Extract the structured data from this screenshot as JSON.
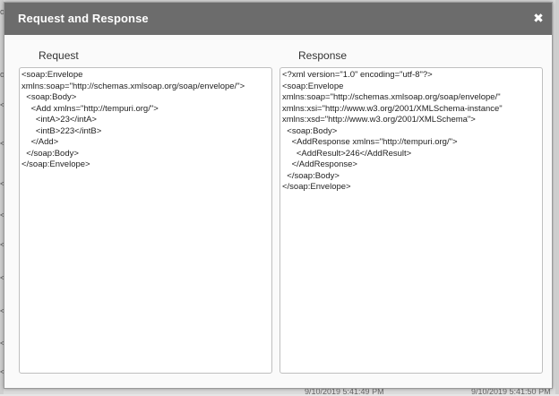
{
  "dialog": {
    "title": "Request and Response",
    "close_glyph": "✖"
  },
  "request": {
    "label": "Request",
    "xml": "<soap:Envelope\nxmlns:soap=\"http://schemas.xmlsoap.org/soap/envelope/\">\n  <soap:Body>\n    <Add xmlns=\"http://tempuri.org/\">\n      <intA>23</intA>\n      <intB>223</intB>\n    </Add>\n  </soap:Body>\n</soap:Envelope>"
  },
  "response": {
    "label": "Response",
    "xml": "<?xml version=\"1.0\" encoding=\"utf-8\"?>\n<soap:Envelope\nxmlns:soap=\"http://schemas.xmlsoap.org/soap/envelope/\"\nxmlns:xsi=\"http://www.w3.org/2001/XMLSchema-instance\"\nxmlns:xsd=\"http://www.w3.org/2001/XMLSchema\">\n  <soap:Body>\n    <AddResponse xmlns=\"http://tempuri.org/\">\n      <AddResult>246</AddResult>\n    </AddResponse>\n  </soap:Body>\n</soap:Envelope>"
  },
  "background": {
    "left_glyphs": [
      "ol",
      "of",
      "<",
      "<",
      "<",
      "<",
      "<",
      "<",
      "<",
      "<",
      "<"
    ],
    "timestamps": [
      "9/10/2019 5:41:49 PM",
      "9/10/2019 5:41:50 PM"
    ]
  },
  "colors": {
    "titlebar": "#6c6c6c",
    "dialog_bg": "#fafafa",
    "box_border": "#bfbfbf"
  }
}
